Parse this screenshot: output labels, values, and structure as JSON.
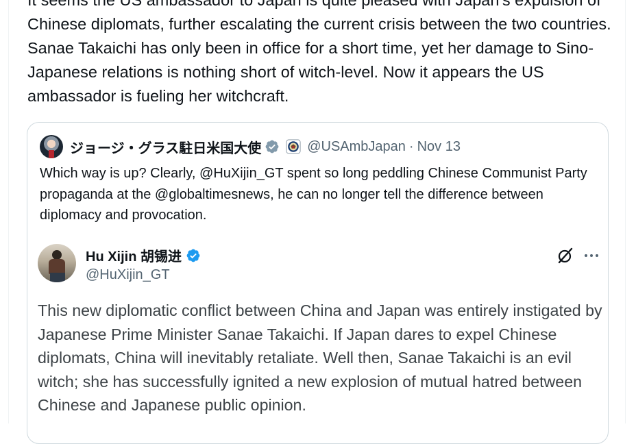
{
  "tweet": {
    "text": "It seems the US ambassador to Japan is quite pleased with Japan's expulsion of Chinese diplomats, further escalating the current crisis between the two countries. Sanae Takaichi has only been in office for a short time, yet her damage to Sino-Japanese relations is nothing short of witch-level. Now it appears the US ambassador is fueling her witchcraft."
  },
  "quote": {
    "display_name": "ジョージ・グラス駐日米国大使",
    "handle": "@USAmbJapan",
    "separator": "·",
    "date": "Nov 13",
    "text": "Which way is up? Clearly, @HuXijin_GT spent so long peddling Chinese Communist Party propaganda at the @globaltimesnews, he can no longer tell the difference between diplomacy and provocation."
  },
  "embedded": {
    "display_name": "Hu Xijin 胡锡进",
    "handle": "@HuXijin_GT",
    "text": "This new diplomatic conflict between China and Japan was entirely instigated by Japanese Prime Minister Sanae Takaichi. If Japan dares to expel Chinese diplomats, China will inevitably retaliate. Well then, Sanae Takaichi is an evil witch; she has successfully ignited a new explosion of mutual hatred between Chinese and Japanese public opinion."
  },
  "icons": {
    "verified": "verified-badge-icon",
    "government_seal": "government-seal-icon",
    "grok": "grok-icon",
    "more": "more-options-icon"
  },
  "colors": {
    "text_primary": "#0f1419",
    "text_secondary": "#536471",
    "verified_blue": "#1d9bf0",
    "border": "#cfd9de"
  }
}
